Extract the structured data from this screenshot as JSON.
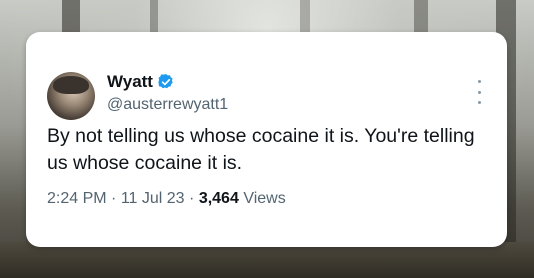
{
  "tweet": {
    "name": "Wyatt",
    "handle": "@austerrewyatt1",
    "text": "By not telling us whose cocaine it is. You're telling us whose cocaine it is.",
    "time": "2:24 PM",
    "date": "11 Jul 23",
    "views_count": "3,464",
    "views_label": "Views",
    "separator": "·"
  },
  "colors": {
    "verified_badge": "#1d9bf0",
    "text_primary": "#0f1419",
    "text_secondary": "#536471"
  }
}
